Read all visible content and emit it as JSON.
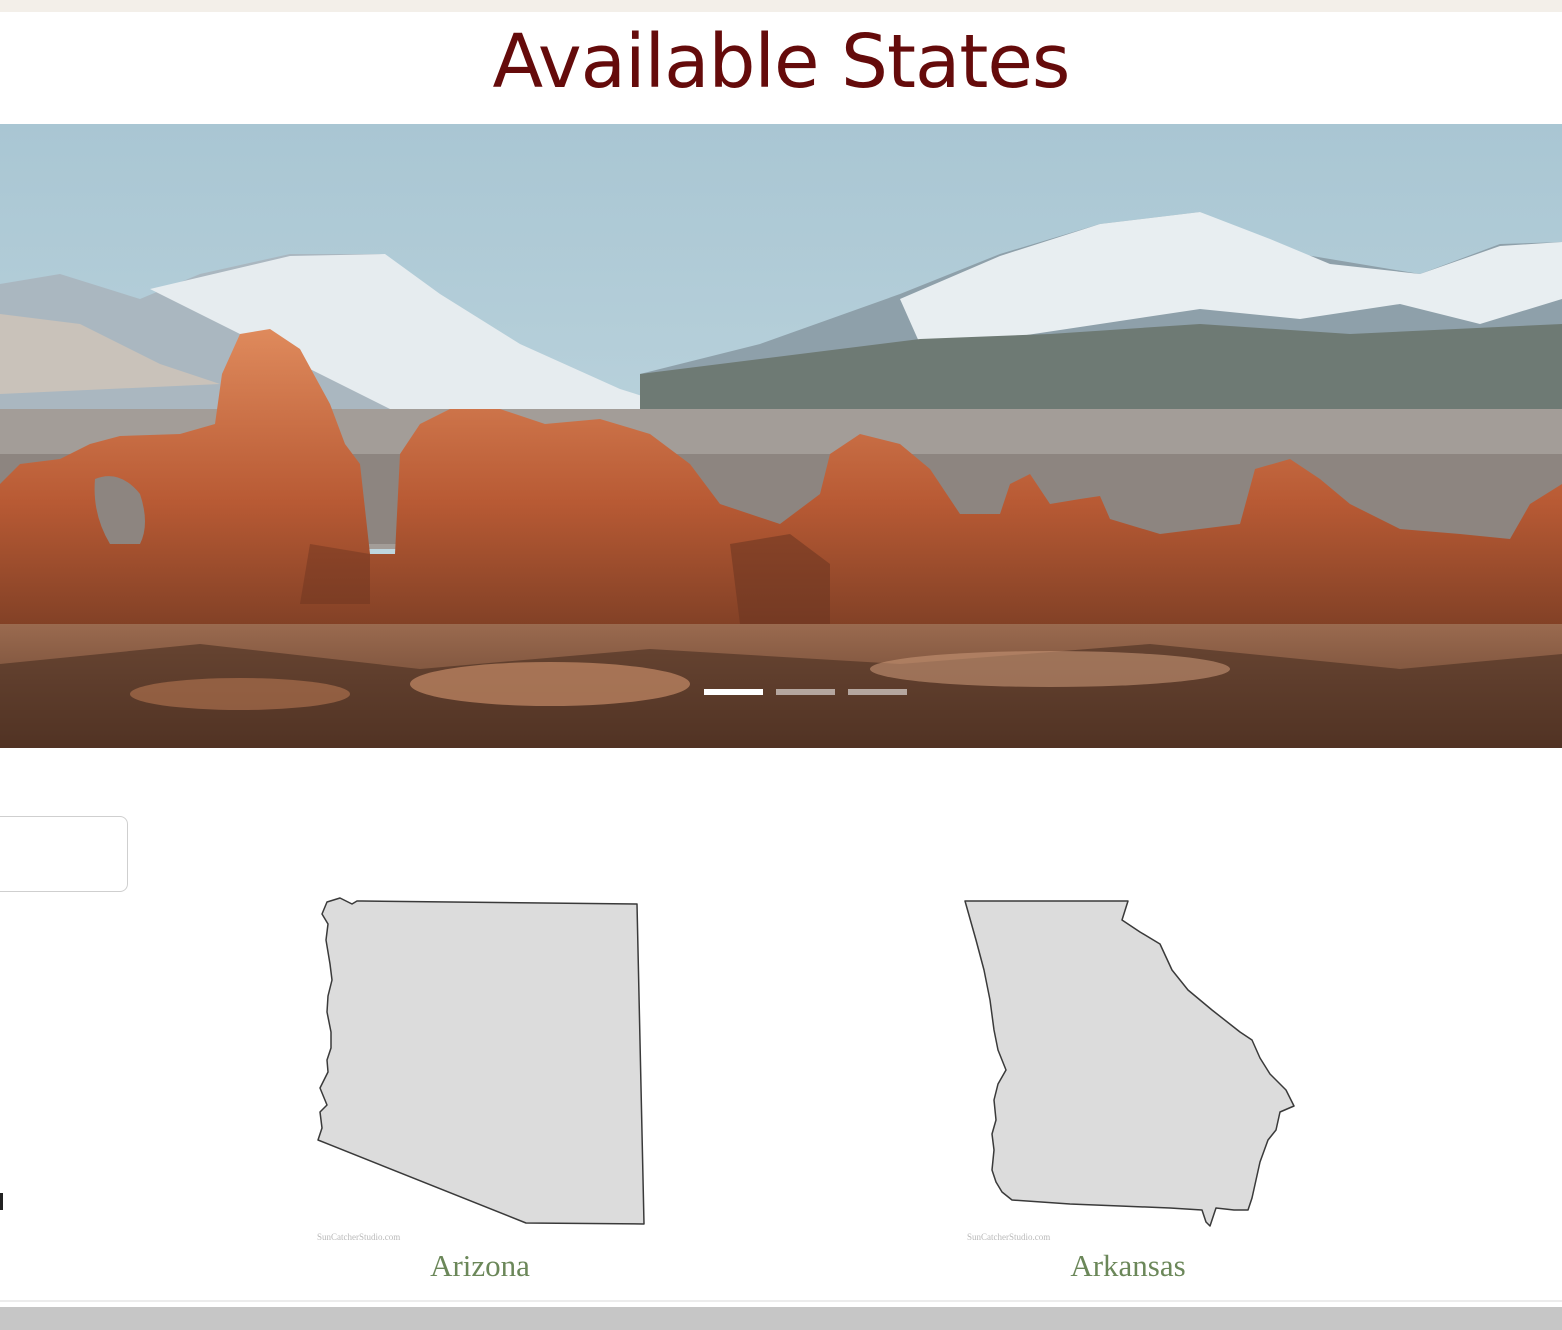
{
  "page": {
    "title": "Available States"
  },
  "hero": {
    "slides_total": 3,
    "active_slide": 1,
    "image_icon": "landscape-photo-icon"
  },
  "states": [
    {
      "name": "Arizona",
      "watermark": "SunCatcherStudio.com",
      "icon": "arizona-outline-icon"
    },
    {
      "name": "Arkansas",
      "watermark": "SunCatcherStudio.com",
      "icon": "state-outline-icon"
    }
  ],
  "colors": {
    "title": "#650b0b",
    "state_label": "#6b8759",
    "map_fill": "#dcdcdc",
    "top_strip": "#f3efe9",
    "bottom_bar": "#c6c6c6"
  }
}
